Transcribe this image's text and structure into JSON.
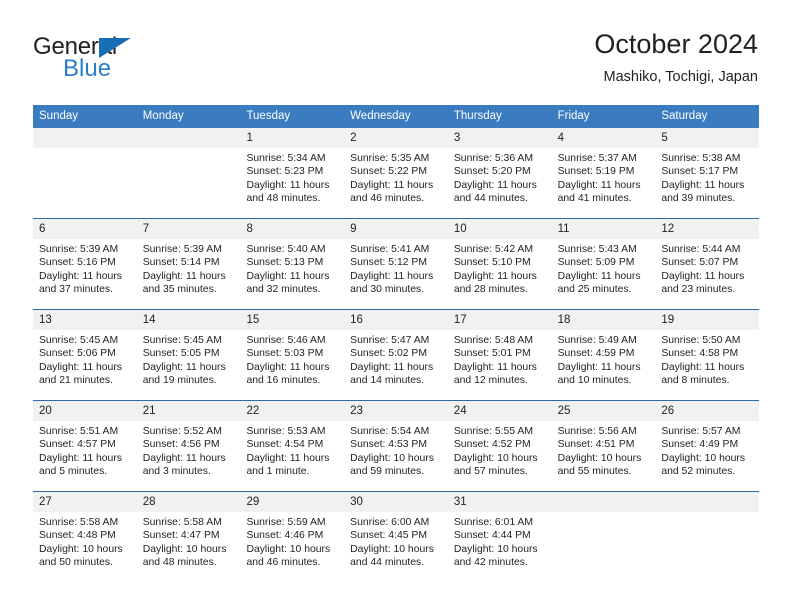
{
  "brand": {
    "name_top": "General",
    "name_bottom": "Blue",
    "triangle_icon": "triangle-icon",
    "accent_dark": "#1a6fb4",
    "accent_light": "#2a7fc9"
  },
  "header": {
    "title": "October 2024",
    "subtitle": "Mashiko, Tochigi, Japan"
  },
  "colors": {
    "header_blue": "#3b7cc0",
    "row_divider": "#2f6aa8",
    "day_strip": "#f1f1f1",
    "text": "#231f20"
  },
  "weekdays": [
    "Sunday",
    "Monday",
    "Tuesday",
    "Wednesday",
    "Thursday",
    "Friday",
    "Saturday"
  ],
  "weeks": [
    [
      {
        "day": "",
        "lines": []
      },
      {
        "day": "",
        "lines": []
      },
      {
        "day": "1",
        "lines": [
          "Sunrise: 5:34 AM",
          "Sunset: 5:23 PM",
          "Daylight: 11 hours",
          "and 48 minutes."
        ]
      },
      {
        "day": "2",
        "lines": [
          "Sunrise: 5:35 AM",
          "Sunset: 5:22 PM",
          "Daylight: 11 hours",
          "and 46 minutes."
        ]
      },
      {
        "day": "3",
        "lines": [
          "Sunrise: 5:36 AM",
          "Sunset: 5:20 PM",
          "Daylight: 11 hours",
          "and 44 minutes."
        ]
      },
      {
        "day": "4",
        "lines": [
          "Sunrise: 5:37 AM",
          "Sunset: 5:19 PM",
          "Daylight: 11 hours",
          "and 41 minutes."
        ]
      },
      {
        "day": "5",
        "lines": [
          "Sunrise: 5:38 AM",
          "Sunset: 5:17 PM",
          "Daylight: 11 hours",
          "and 39 minutes."
        ]
      }
    ],
    [
      {
        "day": "6",
        "lines": [
          "Sunrise: 5:39 AM",
          "Sunset: 5:16 PM",
          "Daylight: 11 hours",
          "and 37 minutes."
        ]
      },
      {
        "day": "7",
        "lines": [
          "Sunrise: 5:39 AM",
          "Sunset: 5:14 PM",
          "Daylight: 11 hours",
          "and 35 minutes."
        ]
      },
      {
        "day": "8",
        "lines": [
          "Sunrise: 5:40 AM",
          "Sunset: 5:13 PM",
          "Daylight: 11 hours",
          "and 32 minutes."
        ]
      },
      {
        "day": "9",
        "lines": [
          "Sunrise: 5:41 AM",
          "Sunset: 5:12 PM",
          "Daylight: 11 hours",
          "and 30 minutes."
        ]
      },
      {
        "day": "10",
        "lines": [
          "Sunrise: 5:42 AM",
          "Sunset: 5:10 PM",
          "Daylight: 11 hours",
          "and 28 minutes."
        ]
      },
      {
        "day": "11",
        "lines": [
          "Sunrise: 5:43 AM",
          "Sunset: 5:09 PM",
          "Daylight: 11 hours",
          "and 25 minutes."
        ]
      },
      {
        "day": "12",
        "lines": [
          "Sunrise: 5:44 AM",
          "Sunset: 5:07 PM",
          "Daylight: 11 hours",
          "and 23 minutes."
        ]
      }
    ],
    [
      {
        "day": "13",
        "lines": [
          "Sunrise: 5:45 AM",
          "Sunset: 5:06 PM",
          "Daylight: 11 hours",
          "and 21 minutes."
        ]
      },
      {
        "day": "14",
        "lines": [
          "Sunrise: 5:45 AM",
          "Sunset: 5:05 PM",
          "Daylight: 11 hours",
          "and 19 minutes."
        ]
      },
      {
        "day": "15",
        "lines": [
          "Sunrise: 5:46 AM",
          "Sunset: 5:03 PM",
          "Daylight: 11 hours",
          "and 16 minutes."
        ]
      },
      {
        "day": "16",
        "lines": [
          "Sunrise: 5:47 AM",
          "Sunset: 5:02 PM",
          "Daylight: 11 hours",
          "and 14 minutes."
        ]
      },
      {
        "day": "17",
        "lines": [
          "Sunrise: 5:48 AM",
          "Sunset: 5:01 PM",
          "Daylight: 11 hours",
          "and 12 minutes."
        ]
      },
      {
        "day": "18",
        "lines": [
          "Sunrise: 5:49 AM",
          "Sunset: 4:59 PM",
          "Daylight: 11 hours",
          "and 10 minutes."
        ]
      },
      {
        "day": "19",
        "lines": [
          "Sunrise: 5:50 AM",
          "Sunset: 4:58 PM",
          "Daylight: 11 hours",
          "and 8 minutes."
        ]
      }
    ],
    [
      {
        "day": "20",
        "lines": [
          "Sunrise: 5:51 AM",
          "Sunset: 4:57 PM",
          "Daylight: 11 hours",
          "and 5 minutes."
        ]
      },
      {
        "day": "21",
        "lines": [
          "Sunrise: 5:52 AM",
          "Sunset: 4:56 PM",
          "Daylight: 11 hours",
          "and 3 minutes."
        ]
      },
      {
        "day": "22",
        "lines": [
          "Sunrise: 5:53 AM",
          "Sunset: 4:54 PM",
          "Daylight: 11 hours",
          "and 1 minute."
        ]
      },
      {
        "day": "23",
        "lines": [
          "Sunrise: 5:54 AM",
          "Sunset: 4:53 PM",
          "Daylight: 10 hours",
          "and 59 minutes."
        ]
      },
      {
        "day": "24",
        "lines": [
          "Sunrise: 5:55 AM",
          "Sunset: 4:52 PM",
          "Daylight: 10 hours",
          "and 57 minutes."
        ]
      },
      {
        "day": "25",
        "lines": [
          "Sunrise: 5:56 AM",
          "Sunset: 4:51 PM",
          "Daylight: 10 hours",
          "and 55 minutes."
        ]
      },
      {
        "day": "26",
        "lines": [
          "Sunrise: 5:57 AM",
          "Sunset: 4:49 PM",
          "Daylight: 10 hours",
          "and 52 minutes."
        ]
      }
    ],
    [
      {
        "day": "27",
        "lines": [
          "Sunrise: 5:58 AM",
          "Sunset: 4:48 PM",
          "Daylight: 10 hours",
          "and 50 minutes."
        ]
      },
      {
        "day": "28",
        "lines": [
          "Sunrise: 5:58 AM",
          "Sunset: 4:47 PM",
          "Daylight: 10 hours",
          "and 48 minutes."
        ]
      },
      {
        "day": "29",
        "lines": [
          "Sunrise: 5:59 AM",
          "Sunset: 4:46 PM",
          "Daylight: 10 hours",
          "and 46 minutes."
        ]
      },
      {
        "day": "30",
        "lines": [
          "Sunrise: 6:00 AM",
          "Sunset: 4:45 PM",
          "Daylight: 10 hours",
          "and 44 minutes."
        ]
      },
      {
        "day": "31",
        "lines": [
          "Sunrise: 6:01 AM",
          "Sunset: 4:44 PM",
          "Daylight: 10 hours",
          "and 42 minutes."
        ]
      },
      {
        "day": "",
        "lines": []
      },
      {
        "day": "",
        "lines": []
      }
    ]
  ]
}
